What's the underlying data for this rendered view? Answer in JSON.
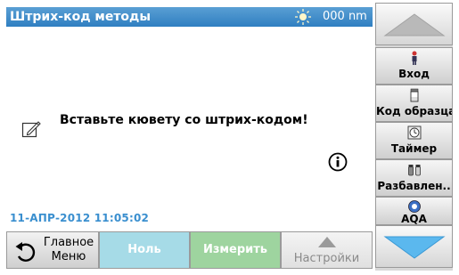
{
  "header": {
    "title": "Штрих-код методы",
    "wavelength": "000 nm"
  },
  "main": {
    "message": "Вставьте кювету со штрих-кодом!",
    "datetime": "11-АПР-2012  11:05:02"
  },
  "bottom": {
    "home_label_line1": "Главное",
    "home_label_line2": "Меню",
    "zero_label": "Ноль",
    "measure_label": "Измерить",
    "settings_label": "Настройки"
  },
  "side": {
    "items": [
      {
        "label": "Вход",
        "icon": "person-icon"
      },
      {
        "label": "Код образца",
        "icon": "sample-vial-icon"
      },
      {
        "label": "Таймер",
        "icon": "timer-icon"
      },
      {
        "label": "Разбавлен..",
        "icon": "dilution-icon"
      },
      {
        "label": "AQA",
        "icon": "aqa-icon"
      }
    ]
  },
  "colors": {
    "title_bar": "#2f7fc1",
    "datetime": "#3a8fcf",
    "zero_button": "#a6dbe7",
    "measure_button": "#9ed49f",
    "scroll_arrow": "#5bb8ee"
  }
}
